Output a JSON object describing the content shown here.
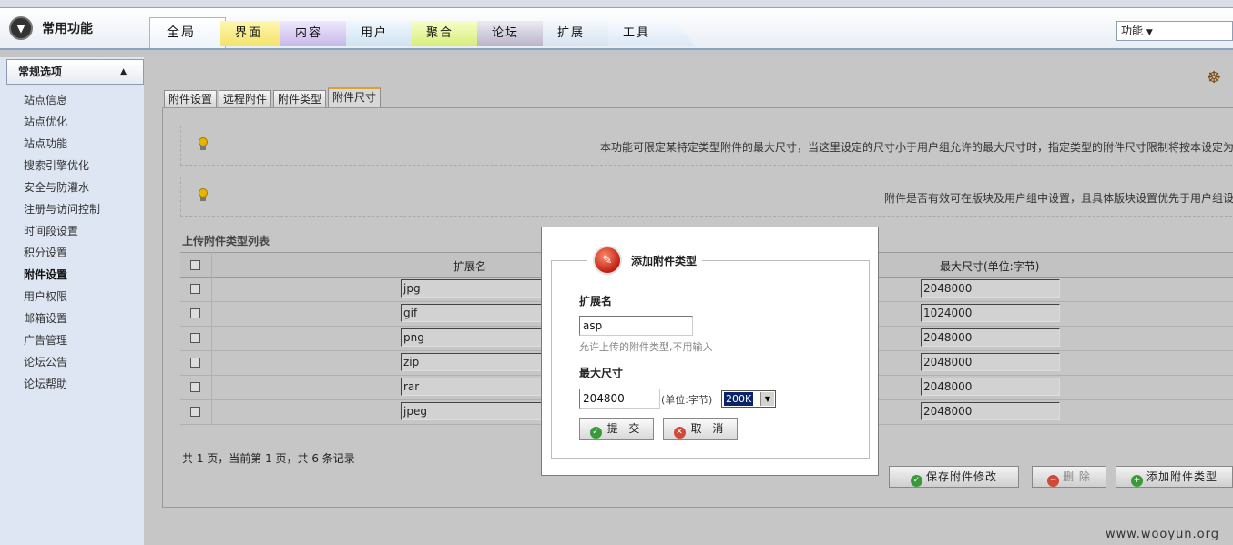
{
  "header": {
    "brand_title": "常用功能",
    "tabs": [
      {
        "label": "全局",
        "color": "#eef4fb"
      },
      {
        "label": "界面",
        "color": "#f3e26a"
      },
      {
        "label": "内容",
        "color": "#c7b8e8"
      },
      {
        "label": "用户",
        "color": "#cfe3ef"
      },
      {
        "label": "聚合",
        "color": "#d8ec7a"
      },
      {
        "label": "论坛",
        "color": "#b9b4c8"
      },
      {
        "label": "扩展",
        "color": "#d7e4f0"
      },
      {
        "label": "工具",
        "color": "#dce8f5"
      }
    ],
    "function_select": "功能"
  },
  "sidebar": {
    "heading": "常规选项",
    "items": [
      {
        "label": "站点信息"
      },
      {
        "label": "站点优化"
      },
      {
        "label": "站点功能"
      },
      {
        "label": "搜索引擎优化"
      },
      {
        "label": "安全与防灌水"
      },
      {
        "label": "注册与访问控制"
      },
      {
        "label": "时间段设置"
      },
      {
        "label": "积分设置"
      },
      {
        "label": "附件设置",
        "active": true
      },
      {
        "label": "用户权限"
      },
      {
        "label": "邮箱设置"
      },
      {
        "label": "广告管理"
      },
      {
        "label": "论坛公告"
      },
      {
        "label": "论坛帮助"
      }
    ]
  },
  "main": {
    "subtabs": [
      {
        "label": "附件设置"
      },
      {
        "label": "远程附件"
      },
      {
        "label": "附件类型"
      },
      {
        "label": "附件尺寸",
        "active": true
      }
    ],
    "tips": [
      "本功能可限定某特定类型附件的最大尺寸，当这里设定的尺寸小于用户组允许的最大尺寸时，指定类型的附件尺寸限制将按本设定为准",
      "附件是否有效可在版块及用户组中设置，且具体版块设置优先于用户组设置"
    ],
    "list_title": "上传附件类型列表",
    "table": {
      "headers": {
        "ext": "扩展名",
        "size": "最大尺寸(单位:字节)"
      },
      "rows": [
        {
          "ext": "jpg",
          "size": "2048000"
        },
        {
          "ext": "gif",
          "size": "1024000"
        },
        {
          "ext": "png",
          "size": "2048000"
        },
        {
          "ext": "zip",
          "size": "2048000"
        },
        {
          "ext": "rar",
          "size": "2048000"
        },
        {
          "ext": "jpeg",
          "size": "2048000"
        }
      ]
    },
    "pager": "共 1 页，当前第 1 页，共 6 条记录",
    "buttons": {
      "save": "保存附件修改",
      "delete": "删 除",
      "add": "添加附件类型"
    }
  },
  "modal": {
    "title": "添加附件类型",
    "ext_label": "扩展名",
    "ext_value": "asp",
    "ext_hint": "允许上传的附件类型,不用输入",
    "size_label": "最大尺寸",
    "size_value": "204800",
    "size_unit": "(单位:字节)",
    "size_select": "200K",
    "submit_label": "提 交",
    "cancel_label": "取 消"
  },
  "watermark": "www.wooyun.org"
}
